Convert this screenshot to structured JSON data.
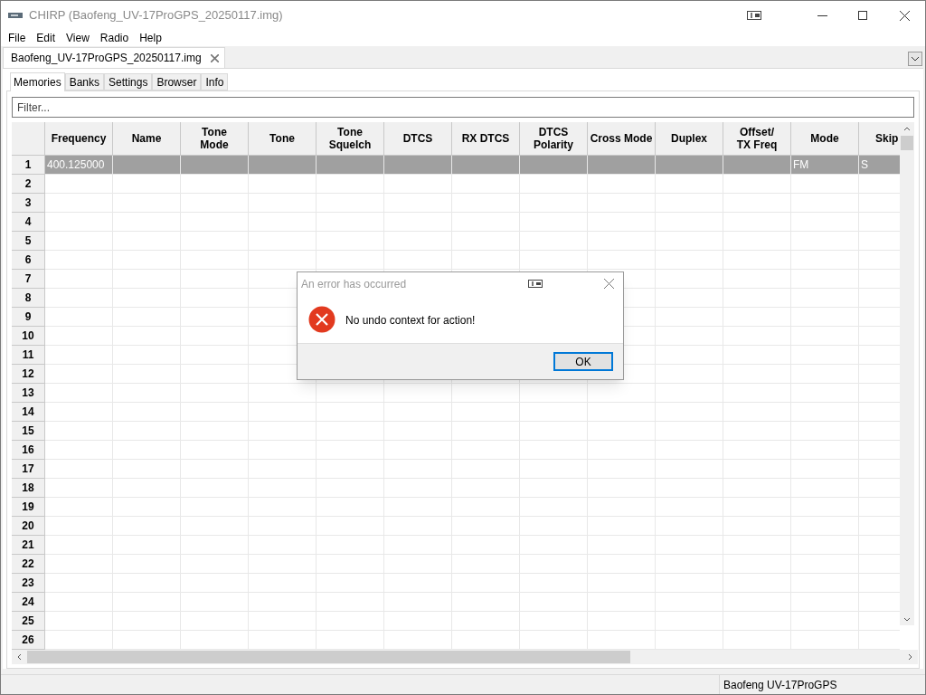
{
  "window": {
    "title": "CHIRP (Baofeng_UV-17ProGPS_20250117.img)"
  },
  "menu": [
    "File",
    "Edit",
    "View",
    "Radio",
    "Help"
  ],
  "file_tab": {
    "label": "Baofeng_UV-17ProGPS_20250117.img"
  },
  "tabs": [
    {
      "label": "Memories",
      "selected": true
    },
    {
      "label": "Banks",
      "selected": false
    },
    {
      "label": "Settings",
      "selected": false
    },
    {
      "label": "Browser",
      "selected": false
    },
    {
      "label": "Info",
      "selected": false
    }
  ],
  "filter": {
    "placeholder": "Filter..."
  },
  "table": {
    "columns": [
      "Frequency",
      "Name",
      "Tone\nMode",
      "Tone",
      "Tone\nSquelch",
      "DTCS",
      "RX DTCS",
      "DTCS\nPolarity",
      "Cross Mode",
      "Duplex",
      "Offset/\nTX Freq",
      "Mode",
      "Skip"
    ],
    "rows": [
      {
        "number": "1",
        "selected": true,
        "cells": [
          "400.125000",
          null,
          null,
          null,
          null,
          null,
          null,
          null,
          null,
          null,
          null,
          "FM",
          "S"
        ]
      },
      {
        "number": "2",
        "selected": false
      },
      {
        "number": "3",
        "selected": false
      },
      {
        "number": "4",
        "selected": false
      },
      {
        "number": "5",
        "selected": false
      },
      {
        "number": "6",
        "selected": false
      },
      {
        "number": "7",
        "selected": false
      },
      {
        "number": "8",
        "selected": false
      },
      {
        "number": "9",
        "selected": false
      },
      {
        "number": "10",
        "selected": false
      },
      {
        "number": "11",
        "selected": false
      },
      {
        "number": "12",
        "selected": false
      },
      {
        "number": "13",
        "selected": false
      },
      {
        "number": "14",
        "selected": false
      },
      {
        "number": "15",
        "selected": false
      },
      {
        "number": "16",
        "selected": false
      },
      {
        "number": "17",
        "selected": false
      },
      {
        "number": "18",
        "selected": false
      },
      {
        "number": "19",
        "selected": false
      },
      {
        "number": "20",
        "selected": false
      },
      {
        "number": "21",
        "selected": false
      },
      {
        "number": "22",
        "selected": false
      },
      {
        "number": "23",
        "selected": false
      },
      {
        "number": "24",
        "selected": false
      },
      {
        "number": "25",
        "selected": false
      },
      {
        "number": "26",
        "selected": false
      }
    ]
  },
  "dialog": {
    "title": "An error has occurred",
    "message": "No undo context for action!",
    "button": "OK"
  },
  "status_bar": {
    "radio": "Baofeng UV-17ProGPS"
  }
}
